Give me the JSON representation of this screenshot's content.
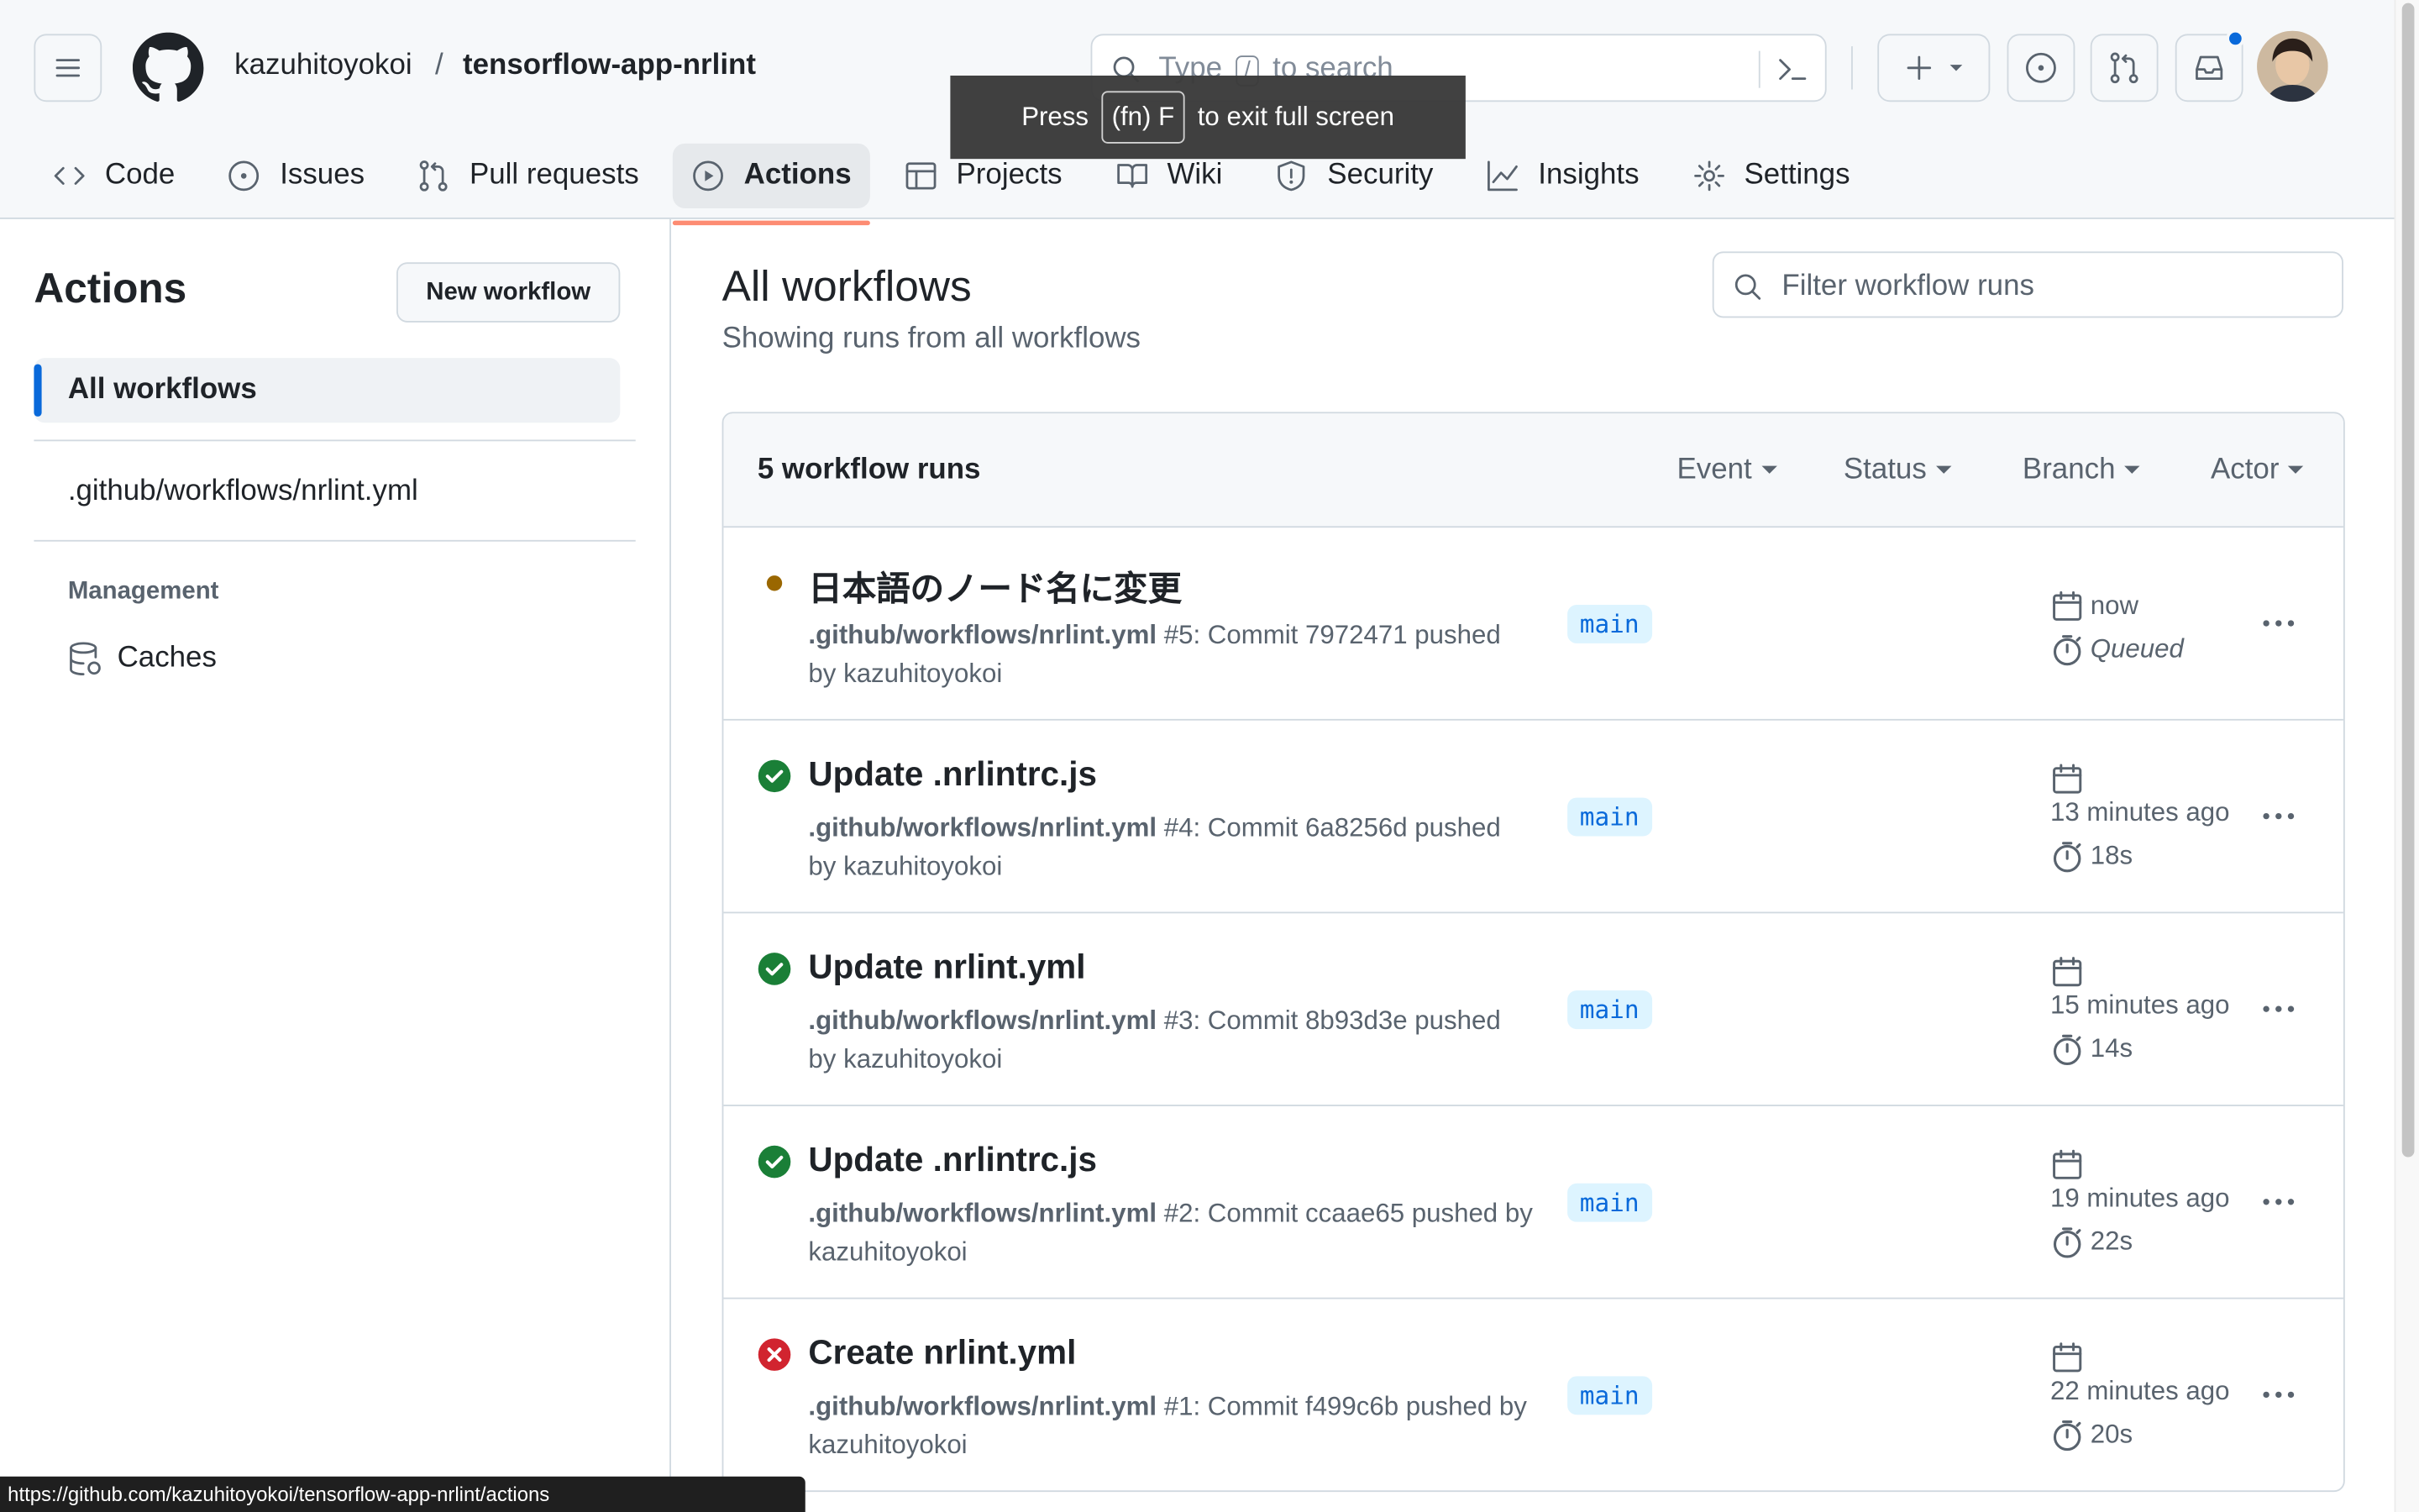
{
  "header": {
    "owner": "kazuhitoyokoi",
    "separator": "/",
    "repo": "tensorflow-app-nrlint",
    "search_prefix": "Type",
    "search_key": "/",
    "search_suffix": "to search"
  },
  "fullscreen_hint": {
    "press": "Press",
    "key": "(fn) F",
    "suffix": "to exit full screen"
  },
  "tabs": [
    {
      "label": "Code"
    },
    {
      "label": "Issues"
    },
    {
      "label": "Pull requests"
    },
    {
      "label": "Actions"
    },
    {
      "label": "Projects"
    },
    {
      "label": "Wiki"
    },
    {
      "label": "Security"
    },
    {
      "label": "Insights"
    },
    {
      "label": "Settings"
    }
  ],
  "sidebar": {
    "title": "Actions",
    "new_workflow": "New workflow",
    "all_workflows": "All workflows",
    "workflow_file": ".github/workflows/nrlint.yml",
    "management_heading": "Management",
    "caches": "Caches"
  },
  "main": {
    "title": "All workflows",
    "subtitle": "Showing runs from all workflows",
    "filter_placeholder": "Filter workflow runs",
    "count_label": "5 workflow runs",
    "filters": {
      "event": "Event",
      "status": "Status",
      "branch": "Branch",
      "actor": "Actor"
    }
  },
  "runs": [
    {
      "status": "queued",
      "title": "日本語のノード名に変更",
      "workflow": ".github/workflows/nrlint.yml",
      "desc": " #5: Commit 7972471 pushed by kazuhitoyokoi",
      "branch": "main",
      "when": "now",
      "duration": "Queued"
    },
    {
      "status": "success",
      "title": "Update .nrlintrc.js",
      "workflow": ".github/workflows/nrlint.yml",
      "desc": " #4: Commit 6a8256d pushed by kazuhitoyokoi",
      "branch": "main",
      "when": "13 minutes ago",
      "duration": "18s"
    },
    {
      "status": "success",
      "title": "Update nrlint.yml",
      "workflow": ".github/workflows/nrlint.yml",
      "desc": " #3: Commit 8b93d3e pushed by kazuhitoyokoi",
      "branch": "main",
      "when": "15 minutes ago",
      "duration": "14s"
    },
    {
      "status": "success",
      "title": "Update .nrlintrc.js",
      "workflow": ".github/workflows/nrlint.yml",
      "desc": " #2: Commit ccaae65 pushed by kazuhitoyokoi",
      "branch": "main",
      "when": "19 minutes ago",
      "duration": "22s"
    },
    {
      "status": "failure",
      "title": "Create nrlint.yml",
      "workflow": ".github/workflows/nrlint.yml",
      "desc": " #1: Commit f499c6b pushed by kazuhitoyokoi",
      "branch": "main",
      "when": "22 minutes ago",
      "duration": "20s"
    }
  ],
  "status_bar_url": "https://github.com/kazuhitoyokoi/tensorflow-app-nrlint/actions",
  "colors": {
    "accent": "#0969da",
    "tab_underline": "#fd8c73",
    "success": "#1a7f37",
    "failure": "#d1242f",
    "queued": "#9a6700"
  }
}
